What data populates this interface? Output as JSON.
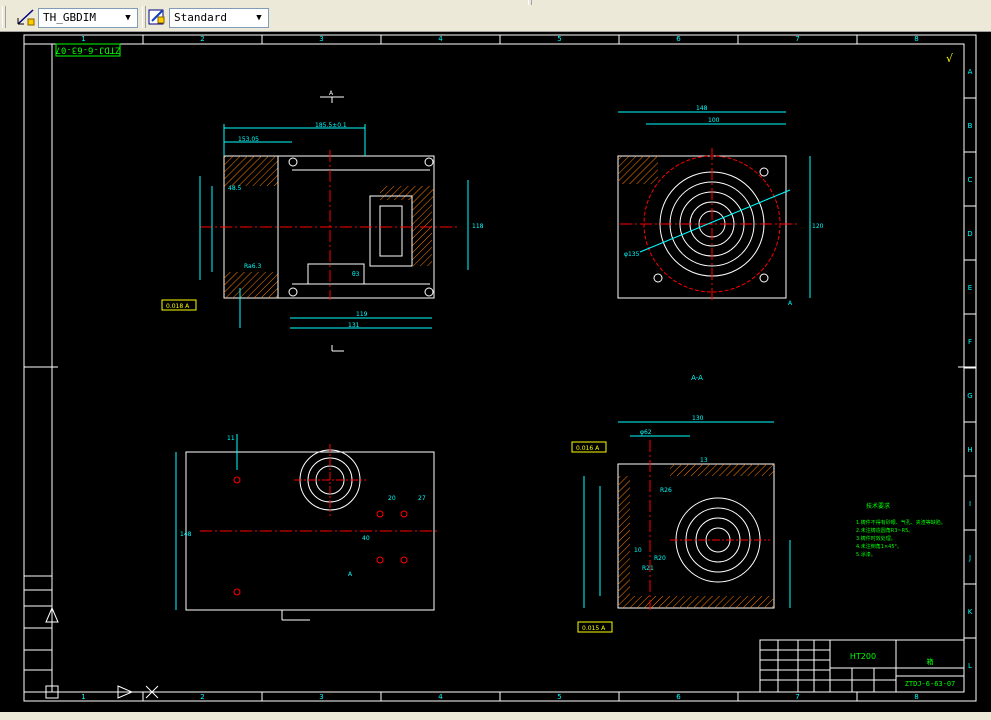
{
  "toolbar": {
    "dimstyle_value": "TH_GBDIM",
    "textstyle_value": "Standard"
  },
  "drawing": {
    "title_stamp": "ZTDJ-6-63-07",
    "material": "HT200",
    "drawing_number": "ZTDJ-6-63-07",
    "part_name": "箱",
    "section_label": "A-A",
    "section_marker": "A",
    "col_labels": [
      "1",
      "2",
      "3",
      "4",
      "5",
      "6",
      "7",
      "8"
    ],
    "row_labels": [
      "A",
      "B",
      "C",
      "D",
      "E",
      "F",
      "G",
      "H",
      "I",
      "J",
      "K",
      "L"
    ],
    "dims_view1": [
      "185.5±0.1",
      "153.05",
      "48.5",
      "118",
      "Ra6.3",
      "θ3",
      "131",
      "119",
      "0.018 A",
      "A"
    ],
    "dims_view2": [
      "148",
      "100",
      "φ135",
      "120",
      "A"
    ],
    "dims_view3": [
      "11",
      "148",
      "20",
      "27",
      "40",
      "A"
    ],
    "dims_view4": [
      "130",
      "φ62",
      "0.016 A",
      "0.015 A",
      "R26",
      "R20",
      "R21",
      "10",
      "13"
    ],
    "notes_title": "技术要求",
    "notes_lines": [
      "1.铸件不得有砂眼、气孔、夹渣等缺陷。",
      "2.未注铸造圆角R3~R5。",
      "3.铸件时效处理。",
      "4.未注倒角1×45°。",
      "5.涂漆。"
    ]
  },
  "colors": {
    "background": "#000000",
    "frame": "#ffffff",
    "dimension": "#00ffff",
    "centerline": "#ff0000",
    "hatch": "#ff7f00",
    "text": "#00ff00",
    "tolerance": "#ffff00"
  },
  "icons": [
    "dimstyle-icon",
    "textstyle-icon",
    "check-mark-icon",
    "ucs-icon"
  ]
}
